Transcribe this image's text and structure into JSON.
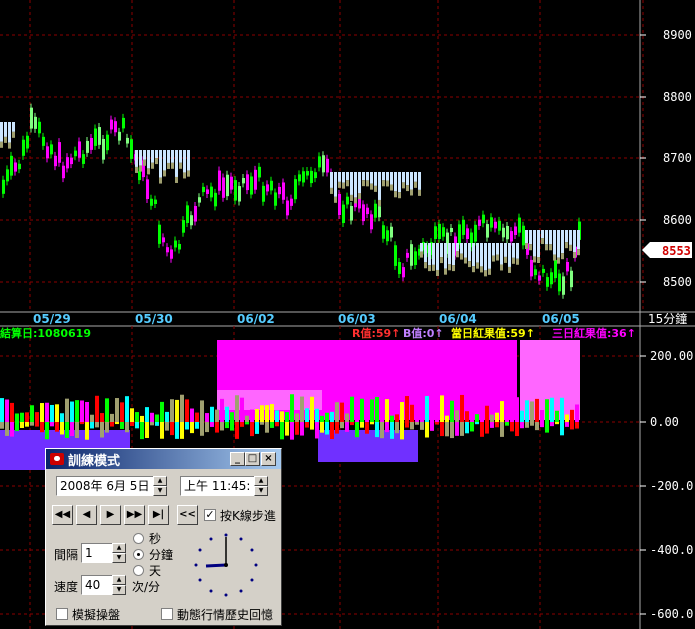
{
  "price_axis": {
    "ticks": [
      "8900",
      "8800",
      "8700",
      "8600",
      "8500"
    ],
    "current_price": "8553",
    "period": "15分鐘"
  },
  "date_axis": [
    "05/29",
    "05/30",
    "06/02",
    "06/03",
    "06/04",
    "06/05"
  ],
  "indicator_axis": {
    "ticks": [
      "200.00",
      "0.00",
      "-200.0",
      "-400.0",
      "-600.0"
    ]
  },
  "indicator_header": {
    "left": "結算日:1080619",
    "r_value": "R值:59↑",
    "b_value": "B值:0↑",
    "today_red": "當日紅果值:59↑",
    "three_day_red": "三日紅果值:36↑"
  },
  "colors": {
    "bg": "#000000",
    "grid": "#8b0000",
    "price_axis": "#ffffff",
    "magenta": "#ff00ff",
    "green": "#00ff00",
    "lightblue": "#cce6ff",
    "olive": "#a0a070"
  },
  "dialog": {
    "title": "訓練模式",
    "date_value": "2008年 6月 5日",
    "time_value": "上午 11:45:",
    "back_button": "<<",
    "step_checkbox_label": "按K線步進",
    "interval_label": "間隔",
    "interval_value": "1",
    "unit_second": "秒",
    "unit_minute": "分鐘",
    "unit_day": "天",
    "speed_label": "速度",
    "speed_value": "40",
    "speed_unit": "次/分",
    "simulate_label": "模擬操盤",
    "replay_label": "動態行情歷史回憶",
    "selected_unit": "minute",
    "step_checked": true
  }
}
